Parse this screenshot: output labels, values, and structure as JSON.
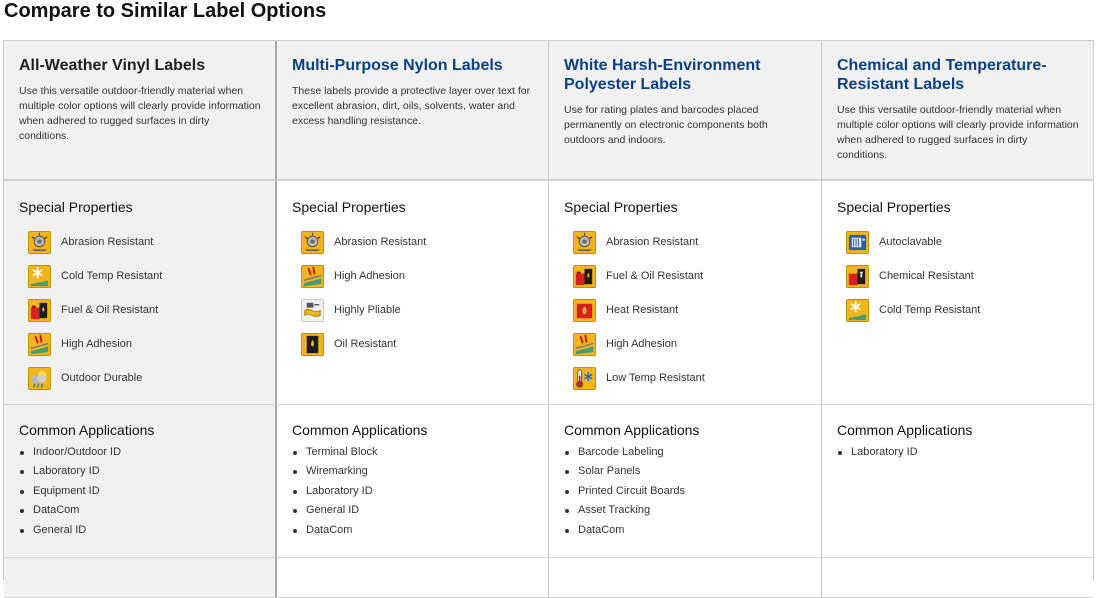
{
  "page": {
    "title": "Compare to Similar Label Options"
  },
  "sections": {
    "special_properties": "Special Properties",
    "common_applications": "Common Applications"
  },
  "products": [
    {
      "title": "All-Weather Vinyl Labels",
      "title_style": "dark",
      "description": "Use this versatile outdoor-friendly material when multiple color options will clearly provide information when adhered to rugged surfaces in dirty conditions.",
      "properties": [
        {
          "label": "Abrasion Resistant",
          "icon": "abrasion-icon"
        },
        {
          "label": "Cold Temp Resistant",
          "icon": "snowflake-icon"
        },
        {
          "label": "Fuel & Oil Resistant",
          "icon": "fuel-oil-icon"
        },
        {
          "label": "High Adhesion",
          "icon": "adhesion-icon"
        },
        {
          "label": "Outdoor Durable",
          "icon": "weather-icon"
        }
      ],
      "applications": [
        "Indoor/Outdoor ID",
        "Laboratory ID",
        "Equipment ID",
        "DataCom",
        "General ID"
      ]
    },
    {
      "title": "Multi-Purpose Nylon Labels",
      "title_style": "blue",
      "description": "These labels provide a protective layer over text for excellent abrasion, dirt, oils, solvents, water and excess handling resistance.",
      "properties": [
        {
          "label": "Abrasion Resistant",
          "icon": "abrasion-icon"
        },
        {
          "label": "High Adhesion",
          "icon": "adhesion-icon"
        },
        {
          "label": "Highly Pliable",
          "icon": "pliable-icon"
        },
        {
          "label": "Oil Resistant",
          "icon": "oil-drop-icon"
        }
      ],
      "applications": [
        "Terminal Block",
        "Wiremarking",
        "Laboratory ID",
        "General ID",
        "DataCom"
      ]
    },
    {
      "title": "White Harsh-Environment Polyester Labels",
      "title_style": "blue",
      "description": "Use for rating plates and barcodes placed permanently on electronic components both outdoors and indoors.",
      "properties": [
        {
          "label": "Abrasion Resistant",
          "icon": "abrasion-icon"
        },
        {
          "label": "Fuel & Oil Resistant",
          "icon": "fuel-oil-icon"
        },
        {
          "label": "Heat Resistant",
          "icon": "heat-icon"
        },
        {
          "label": "High Adhesion",
          "icon": "adhesion-icon"
        },
        {
          "label": "Low Temp Resistant",
          "icon": "thermometer-icon"
        }
      ],
      "applications": [
        "Barcode Labeling",
        "Solar Panels",
        "Printed Circuit Boards",
        "Asset Tracking",
        "DataCom"
      ]
    },
    {
      "title": "Chemical and Temperature-Resistant Labels",
      "title_style": "blue",
      "description": "Use this versatile outdoor-friendly material when multiple color options will clearly provide information when adhered to rugged surfaces in dirty conditions.",
      "properties": [
        {
          "label": "Autoclavable",
          "icon": "autoclave-icon"
        },
        {
          "label": "Chemical Resistant",
          "icon": "chemical-icon"
        },
        {
          "label": "Cold Temp Resistant",
          "icon": "snowflake-icon"
        }
      ],
      "applications": [
        "Laboratory ID"
      ]
    }
  ],
  "colors": {
    "title_blue": "#0c3f83",
    "icon_yellow": "#f2b51c",
    "panel_gray": "#f1f1f1"
  }
}
